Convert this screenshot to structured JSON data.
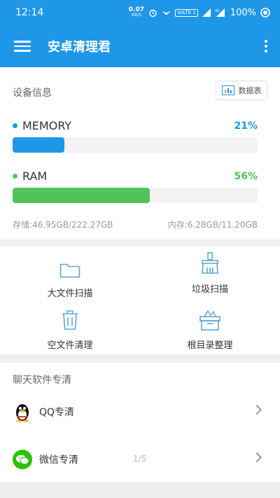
{
  "status_bar": {
    "time": "12:14",
    "net_speed_value": "0.07",
    "net_speed_unit": "KB/S",
    "volte": "VoLTE 1",
    "battery": "100%"
  },
  "app_bar": {
    "title": "安卓清理君"
  },
  "device_info": {
    "title": "设备信息",
    "data_table_label": "数据表",
    "memory": {
      "label": "MEMORY",
      "percent_text": "21%",
      "fraction": 0.21,
      "color": "#1e97e8"
    },
    "ram": {
      "label": "RAM",
      "percent_text": "56%",
      "fraction": 0.56,
      "color": "#52c35a"
    },
    "storage_text": "存储:46.95GB/222.27GB",
    "ram_text": "内存:6.28GB/11.20GB"
  },
  "tools": {
    "large_file_scan": "大文件扫描",
    "junk_scan": "垃圾扫描",
    "empty_file_clean": "空文件清理",
    "root_dir_organize": "根目录整理",
    "icon_color": "#5aa6d6"
  },
  "chat_clean": {
    "title": "聊天软件专清",
    "qq_label": "QQ专清",
    "wechat_label": "微信专清",
    "pager": "1/5"
  }
}
